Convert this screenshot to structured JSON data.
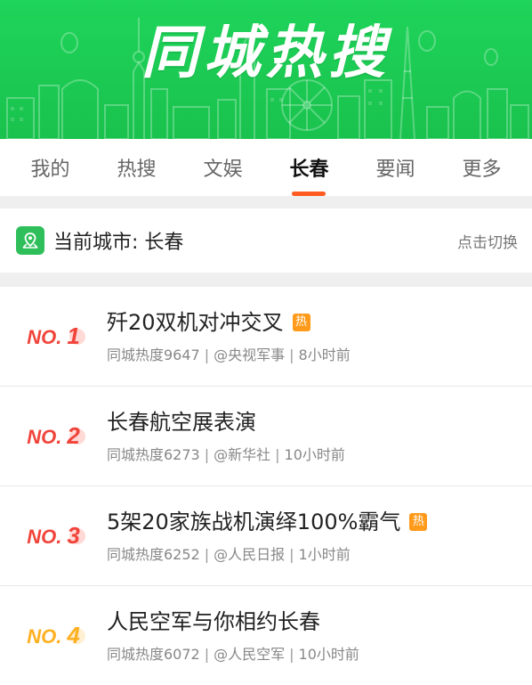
{
  "banner": {
    "title": "同城热搜"
  },
  "tabs": [
    {
      "label": "我的",
      "active": false
    },
    {
      "label": "热搜",
      "active": false
    },
    {
      "label": "文娱",
      "active": false
    },
    {
      "label": "长春",
      "active": true
    },
    {
      "label": "要闻",
      "active": false
    },
    {
      "label": "更多",
      "active": false
    }
  ],
  "city": {
    "label": "当前城市: 长春",
    "switch_label": "点击切换",
    "icon": "location-map-icon"
  },
  "items": [
    {
      "rank_prefix": "NO.",
      "rank_num": "1",
      "rank_color": "#f0443a",
      "title": "歼20双机对冲交叉",
      "hot": true,
      "hot_label": "热",
      "heat": "同城热度9647",
      "source": "@央视军事",
      "time": "8小时前"
    },
    {
      "rank_prefix": "NO.",
      "rank_num": "2",
      "rank_color": "#f0443a",
      "title": "长春航空展表演",
      "hot": false,
      "hot_label": "",
      "heat": "同城热度6273",
      "source": "@新华社",
      "time": "10小时前"
    },
    {
      "rank_prefix": "NO.",
      "rank_num": "3",
      "rank_color": "#f0443a",
      "title": "5架20家族战机演绎100%霸气",
      "hot": true,
      "hot_label": "热",
      "heat": "同城热度6252",
      "source": "@人民日报",
      "time": "1小时前"
    },
    {
      "rank_prefix": "NO.",
      "rank_num": "4",
      "rank_color": "#ffb020",
      "title": "人民空军与你相约长春",
      "hot": false,
      "hot_label": "",
      "heat": "同城热度6072",
      "source": "@人民空军",
      "time": "10小时前"
    }
  ],
  "colors": {
    "banner_green": "#1fd45a",
    "accent_orange": "#ff5a1f",
    "hot_badge": "#ff9a1a"
  }
}
